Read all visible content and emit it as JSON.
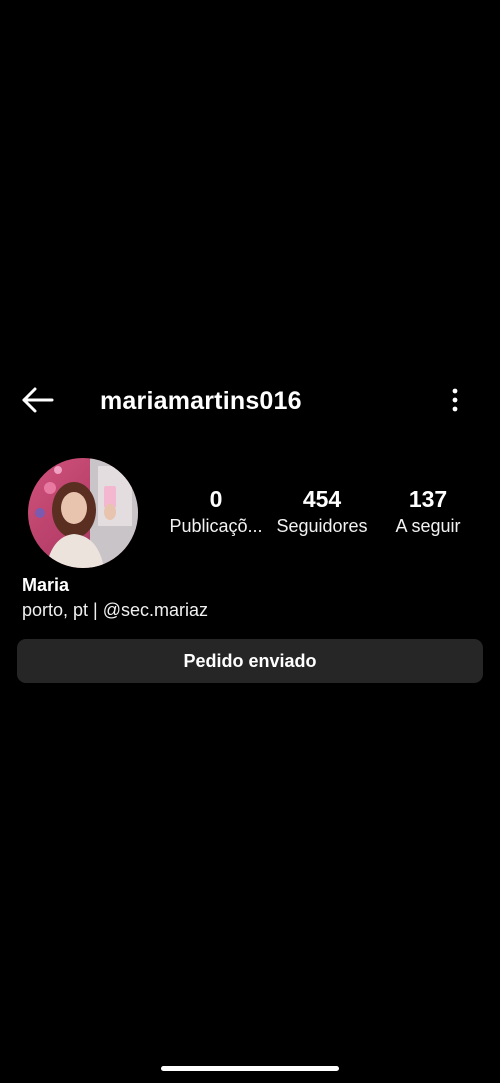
{
  "header": {
    "username": "mariamartins016",
    "back_icon": "arrow-left-icon",
    "menu_icon": "more-vertical-icon"
  },
  "profile": {
    "avatar_icon": "profile-photo",
    "stats": {
      "posts": {
        "value": "0",
        "label": "Publicaçõ..."
      },
      "followers": {
        "value": "454",
        "label": "Seguidores"
      },
      "following": {
        "value": "137",
        "label": "A seguir"
      }
    },
    "display_name": "Maria",
    "bio_text": "porto, pt | ",
    "bio_mention": "@sec.mariaz",
    "request_button_label": "Pedido enviado"
  },
  "colors": {
    "background": "#000000",
    "text": "#ffffff",
    "button_bg": "#262626"
  }
}
